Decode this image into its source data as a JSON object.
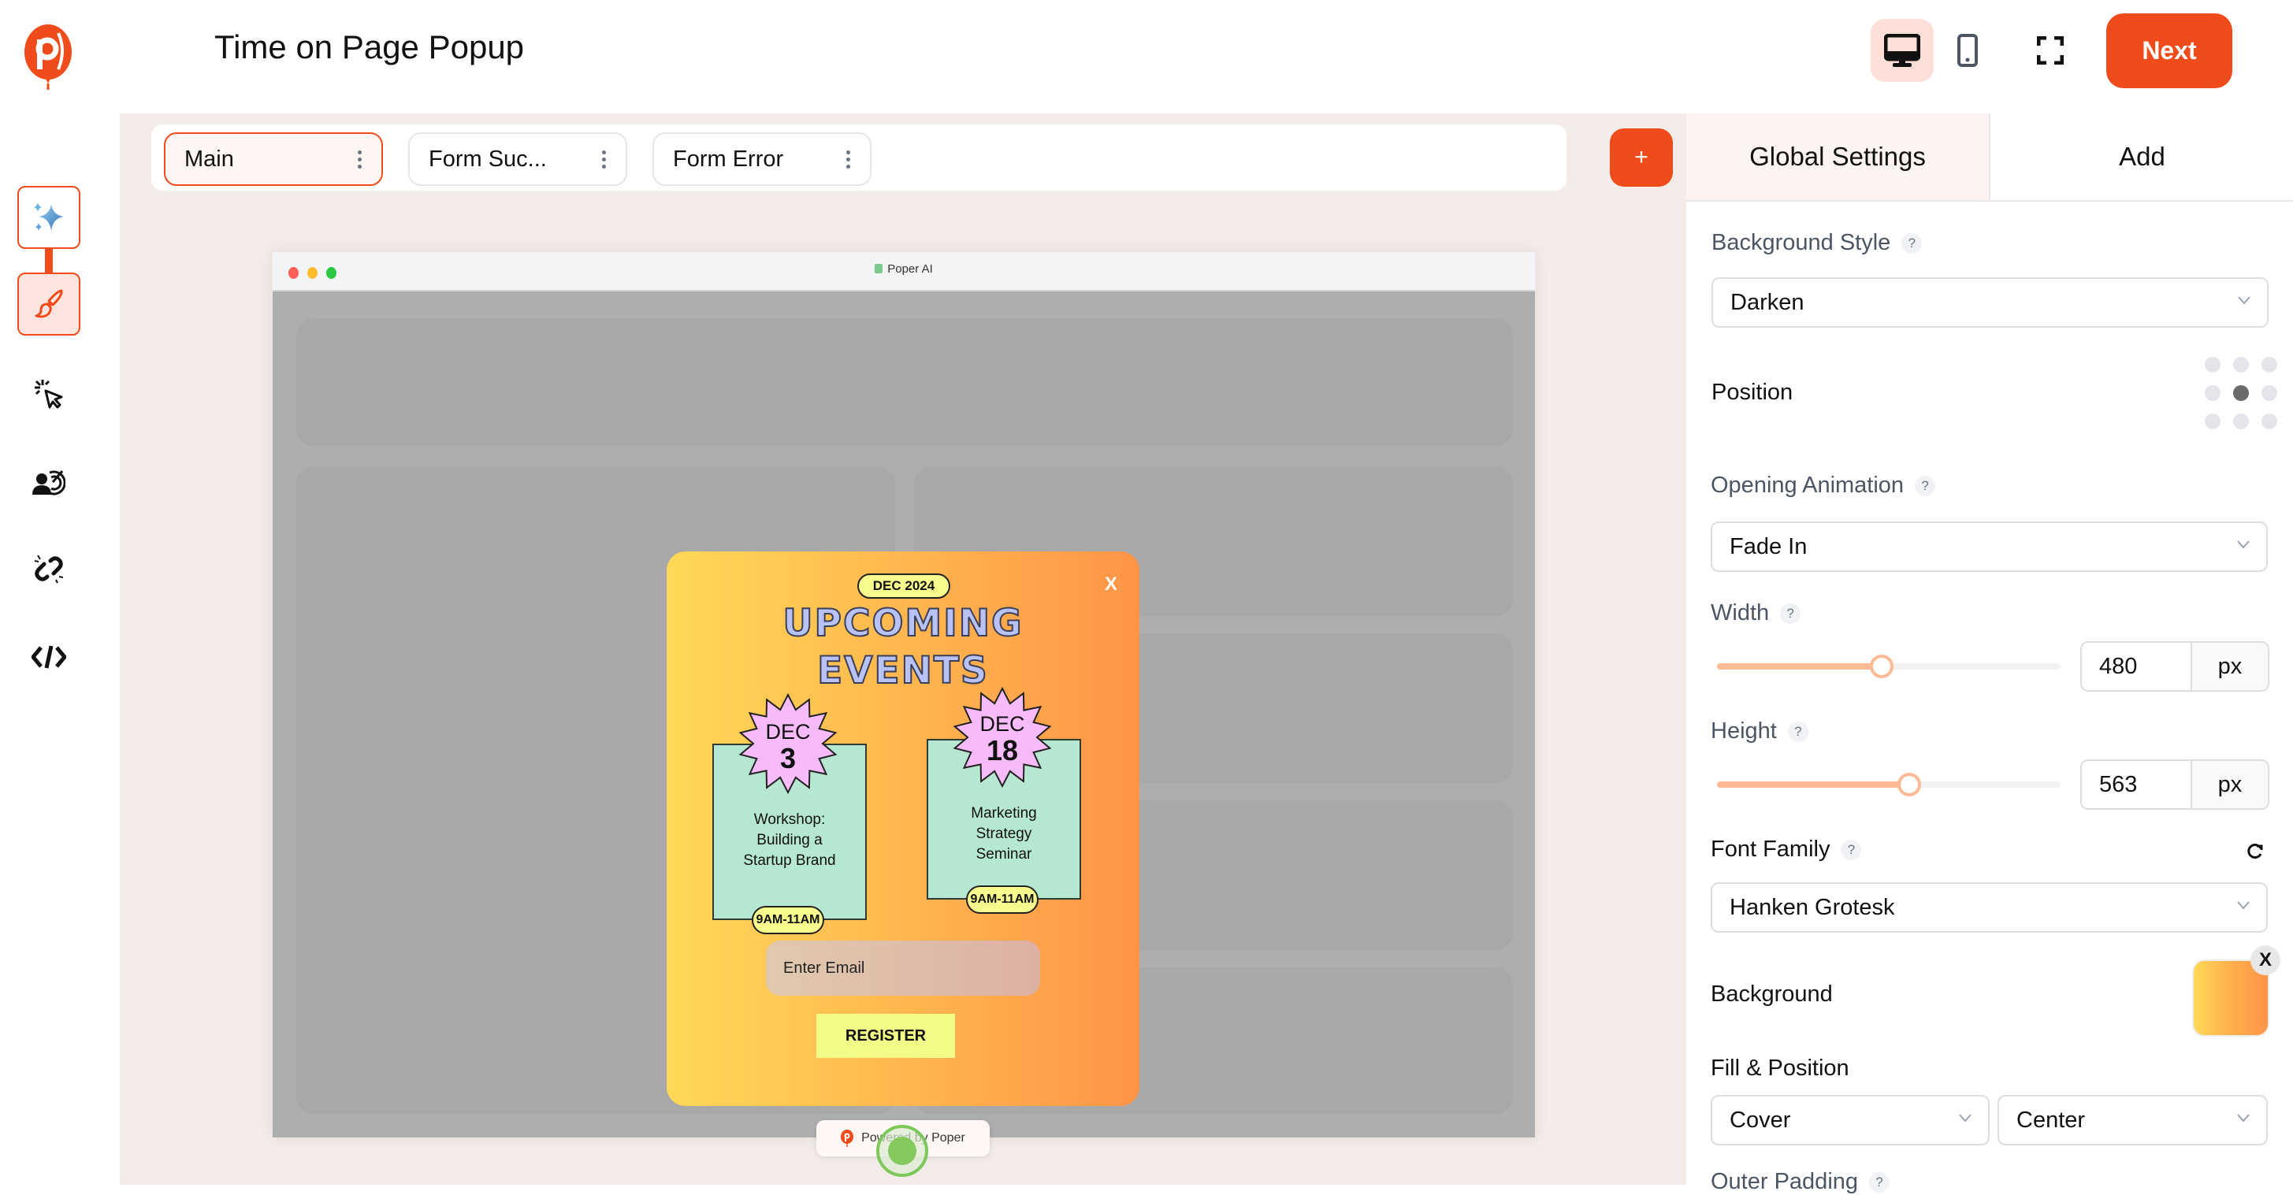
{
  "header": {
    "title": "Time on Page Popup",
    "next_label": "Next",
    "desktop_view": "desktop-view",
    "mobile_view": "mobile-view",
    "fullscreen": "fullscreen"
  },
  "sidebar": {
    "items": [
      {
        "name": "ai-sparkle",
        "icon": "sparkle-icon",
        "active": false
      },
      {
        "name": "design",
        "icon": "paintbrush-icon",
        "active": true
      },
      {
        "name": "triggers",
        "icon": "click-cursor-icon",
        "active": false
      },
      {
        "name": "targeting",
        "icon": "audience-target-icon",
        "active": false
      },
      {
        "name": "integrations",
        "icon": "link-icon",
        "active": false
      },
      {
        "name": "embed-code",
        "icon": "code-icon",
        "active": false
      }
    ]
  },
  "pages": {
    "tabs": [
      {
        "label": "Main",
        "active": true
      },
      {
        "label": "Form Suc...",
        "active": false
      },
      {
        "label": "Form Error",
        "active": false
      }
    ],
    "add_label": "+"
  },
  "browser": {
    "url_label": "Poper AI"
  },
  "popup": {
    "month_chip": "DEC 2024",
    "close_label": "X",
    "headline_line1": "UPCOMING",
    "headline_line2": "EVENTS",
    "events": [
      {
        "month": "DEC",
        "day": "3",
        "title_lines": [
          "Workshop:",
          "Building a",
          "Startup Brand"
        ],
        "time": "9AM-11AM"
      },
      {
        "month": "DEC",
        "day": "18",
        "title_lines": [
          "Marketing",
          "Strategy",
          "Seminar"
        ],
        "time": "9AM-11AM"
      }
    ],
    "email_placeholder": "Enter Email",
    "register_label": "REGISTER",
    "powered_by": "Powered by Poper"
  },
  "settings": {
    "tabs": [
      {
        "label": "Global Settings",
        "active": true
      },
      {
        "label": "Add",
        "active": false
      }
    ],
    "background_style": {
      "label": "Background Style",
      "value": "Darken"
    },
    "position": {
      "label": "Position",
      "selected": "middle-center"
    },
    "opening_animation": {
      "label": "Opening Animation",
      "value": "Fade In"
    },
    "width": {
      "label": "Width",
      "value": "480",
      "unit": "px",
      "slider_fraction": 0.48
    },
    "height": {
      "label": "Height",
      "value": "563",
      "unit": "px",
      "slider_fraction": 0.56
    },
    "font_family": {
      "label": "Font Family",
      "value": "Hanken Grotesk"
    },
    "background": {
      "label": "Background",
      "gradient_from": "#ffd957",
      "gradient_to": "#ff9447",
      "remove_label": "X"
    },
    "fill_position": {
      "label": "Fill & Position",
      "fill": "Cover",
      "position": "Center"
    },
    "outer_padding": {
      "label": "Outer Padding"
    }
  },
  "colors": {
    "brand": "#f04c1b",
    "brand_light": "#fddfd8",
    "slider": "#ffb995",
    "popup_card": "#b6e7d0",
    "starburst": "#f8bbf9",
    "chip": "#f8fc8c"
  }
}
